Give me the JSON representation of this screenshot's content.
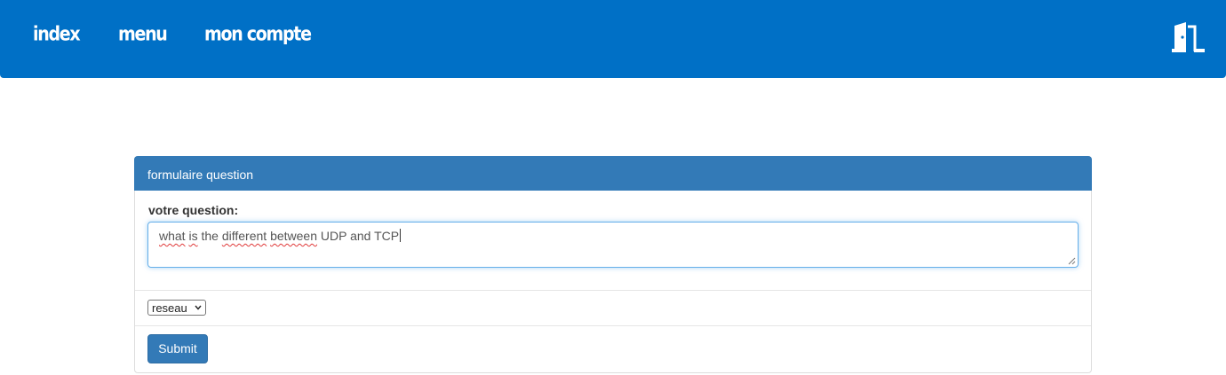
{
  "navbar": {
    "links": [
      {
        "label": "index"
      },
      {
        "label": "menu"
      },
      {
        "label": "mon compte"
      }
    ],
    "exit_icon": "door-exit-icon",
    "color": "#0070c6"
  },
  "form": {
    "header": "formulaire question",
    "question_label": "votre question:",
    "question_value": {
      "w1": "what",
      "w2": " ",
      "w3": "is",
      "w4": " the ",
      "w5": "different",
      "w6": " ",
      "w7": "between",
      "w8": " UDP and TCP"
    },
    "category_selected": "reseau",
    "submit_label": "Submit",
    "header_color": "#337ab7"
  }
}
